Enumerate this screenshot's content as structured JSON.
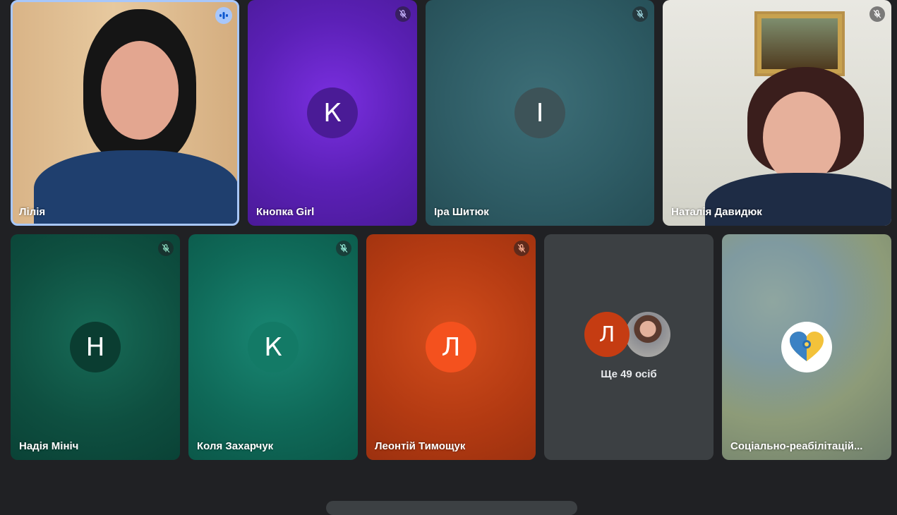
{
  "participants": [
    {
      "name": "Лілія",
      "state": "speaking",
      "kind": "video"
    },
    {
      "name": "Кнопка Girl",
      "state": "muted",
      "kind": "avatar",
      "initial": "К",
      "tile_color": "#5b20b6",
      "avatar_color": "#4a1b96"
    },
    {
      "name": "Іра Шитюк",
      "state": "muted",
      "kind": "avatar",
      "initial": "І",
      "tile_color": "#2f5d66",
      "avatar_color": "#3d5358"
    },
    {
      "name": "Наталія Давидюк",
      "state": "muted",
      "kind": "video"
    },
    {
      "name": "Надія Мініч",
      "state": "muted",
      "kind": "avatar",
      "initial": "Н",
      "tile_color": "#0e4f40",
      "avatar_color": "#0a3d31"
    },
    {
      "name": "Коля Захарчук",
      "state": "muted",
      "kind": "avatar",
      "initial": "К",
      "tile_color": "#0f6958",
      "avatar_color": "#137a66"
    },
    {
      "name": "Леонтій Тимощук",
      "state": "muted",
      "kind": "avatar",
      "initial": "Л",
      "tile_color": "#b33a12",
      "avatar_color": "#f4511e"
    },
    {
      "name": "Соціально-реабілітацій...",
      "state": "none",
      "kind": "logo"
    }
  ],
  "overflow": {
    "label": "Ще 49 осіб",
    "initial": "Л",
    "avatar_color": "#c53c12"
  },
  "icons": {
    "muted": "mic-off-icon",
    "speaking": "audio-wave-icon",
    "logo": "heart-logo-icon"
  }
}
